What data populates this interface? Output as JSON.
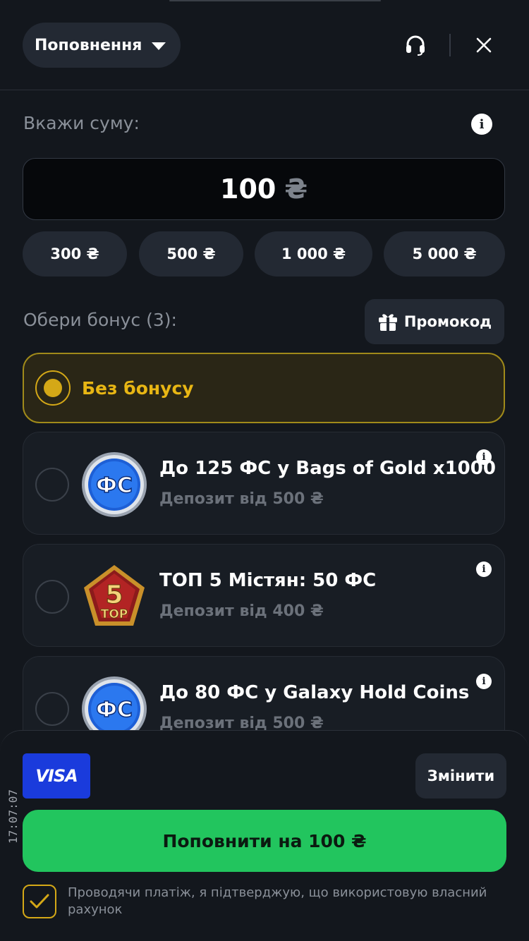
{
  "header": {
    "mode_label": "Поповнення",
    "support_icon": "headset-icon",
    "close_icon": "close-icon"
  },
  "amount": {
    "label": "Вкажи суму:",
    "value": "100",
    "currency": "₴",
    "info_icon": "info-icon",
    "presets": [
      "300 ₴",
      "500 ₴",
      "1 000 ₴",
      "5 000 ₴"
    ]
  },
  "bonus": {
    "label": "Обери бонус (3):",
    "promo_label": "Промокод",
    "promo_icon": "gift-icon",
    "none_label": "Без бонусу",
    "selected": "none",
    "items": [
      {
        "title": "До 125 ФС у Bags of Gold x1000",
        "subtitle": "Депозит від 500 ₴",
        "image_text": "ФС",
        "icon": "free-spins-coin-icon"
      },
      {
        "title": "ТОП 5 Містян: 50 ФС",
        "subtitle": "Депозит від 400 ₴",
        "image_text": "5",
        "image_subtext": "TOP",
        "icon": "top5-badge-icon"
      },
      {
        "title": "До 80 ФС у Galaxy Hold Coins",
        "subtitle": "Депозит від 500 ₴",
        "image_text": "ФС",
        "icon": "free-spins-coin-icon"
      }
    ]
  },
  "payment": {
    "method": "VISA",
    "change_label": "Змінити",
    "submit_label": "Поповнити на 100 ₴",
    "consent_checked": true,
    "consent_text": "Проводячи платіж, я підтверджую, що використовую власний рахунок"
  },
  "status": {
    "time": "17:07:07"
  },
  "colors": {
    "background": "#13171d",
    "accent_yellow": "#e8b614",
    "success_green": "#22c55e",
    "visa_blue": "#1a3bdc"
  }
}
